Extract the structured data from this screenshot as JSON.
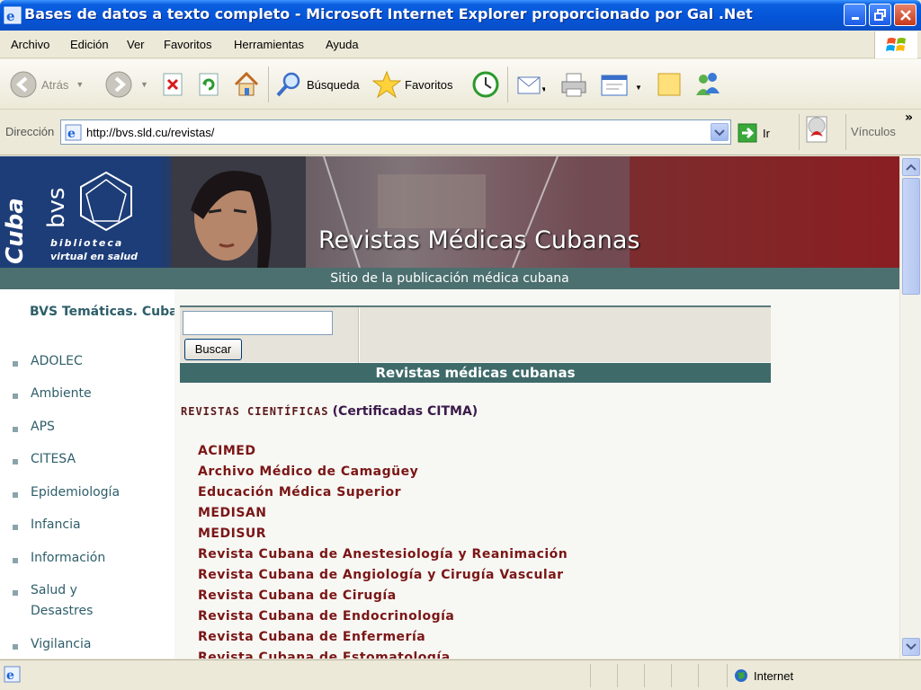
{
  "window": {
    "title": "Bases de datos a texto completo - Microsoft Internet Explorer proporcionado por Gal .Net"
  },
  "menu": [
    "Archivo",
    "Edición",
    "Ver",
    "Favoritos",
    "Herramientas",
    "Ayuda"
  ],
  "toolbar": {
    "back": "Atrás",
    "search": "Búsqueda",
    "favorites": "Favoritos"
  },
  "address": {
    "label": "Dirección",
    "url": "http://bvs.sld.cu/revistas/",
    "go": "Ir",
    "links": "Vínculos"
  },
  "banner": {
    "logo_country": "Cuba",
    "logo_bvs": "bvs",
    "logo_line1": "biblioteca",
    "logo_line2": "virtual en salud",
    "title": "Revistas Médicas Cubanas",
    "subtitle": "Sitio de la publicación médica cubana"
  },
  "sidebar": {
    "title": "BVS Temáticas. Cuba",
    "items": [
      "ADOLEC",
      "Ambiente",
      "APS",
      "CITESA",
      "Epidemiología",
      "Infancia",
      "Información",
      "Salud y\nDesastres",
      "Vigilancia"
    ]
  },
  "search": {
    "button": "Buscar",
    "value": ""
  },
  "section": {
    "title": "Revistas médicas cubanas",
    "header_a": "REVISTAS CIENTÍFICAS",
    "header_b": "(Certificadas CITMA)"
  },
  "journals": [
    "ACIMED",
    "Archivo Médico de Camagüey",
    "Educación Médica Superior",
    "MEDISAN",
    "MEDISUR",
    "Revista Cubana de Anestesiología y Reanimación",
    "Revista Cubana de Angiología y Cirugía Vascular",
    "Revista Cubana de Cirugía",
    "Revista Cubana de Endocrinología",
    "Revista Cubana de Enfermería",
    "Revista Cubana de Estomatología"
  ],
  "status": {
    "zone": "Internet"
  },
  "colors": {
    "titlebar": "#0554d8",
    "banner_red": "#8a1e22",
    "teal_bar": "#4c6f6f",
    "journal_text": "#7a1616"
  }
}
